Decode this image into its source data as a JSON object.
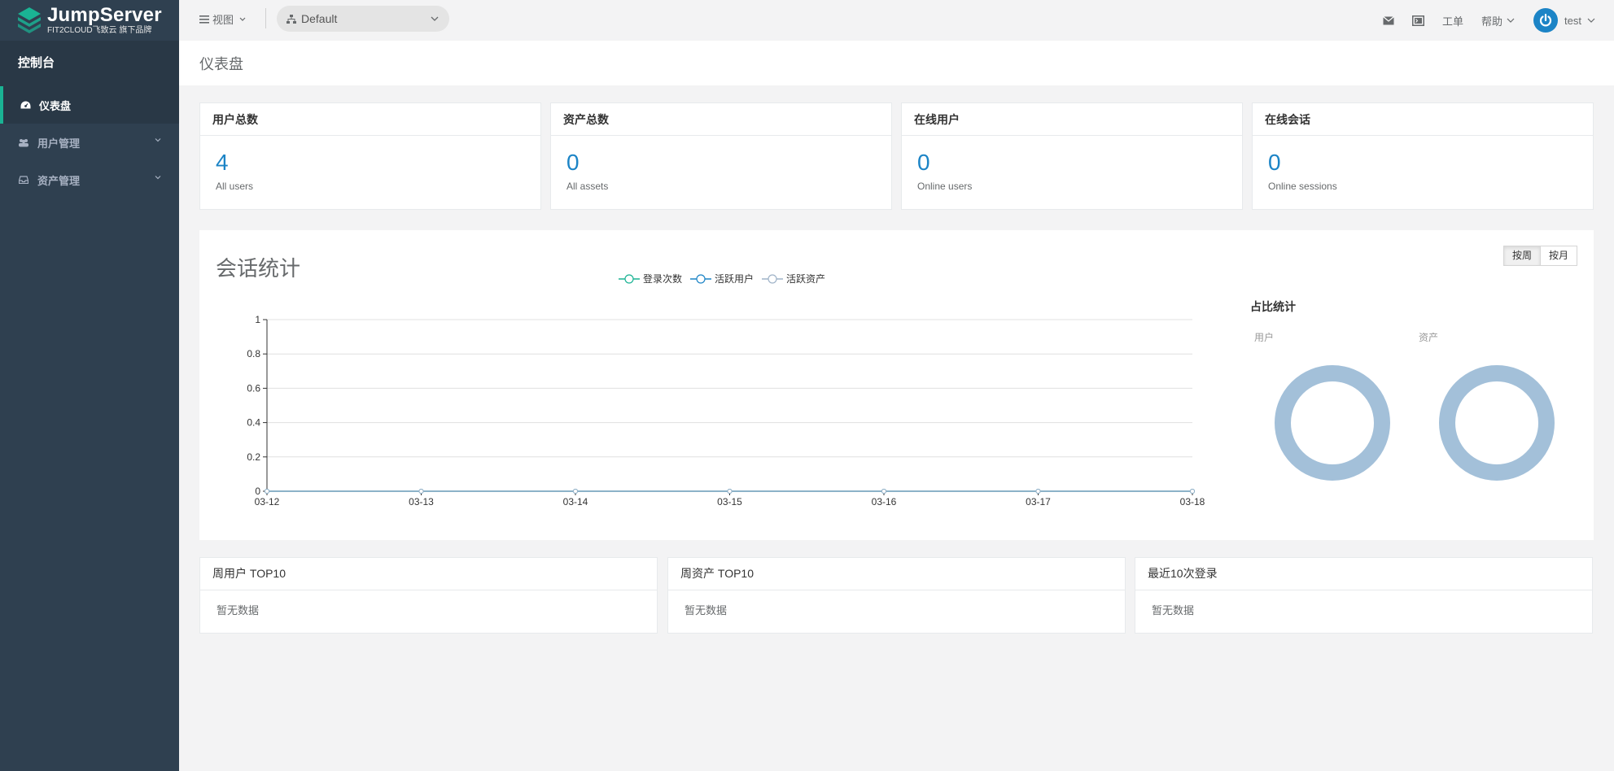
{
  "brand": {
    "title": "JumpServer",
    "subtitle": "FIT2CLOUD飞致云 旗下品牌"
  },
  "sidebar": {
    "console_label": "控制台",
    "items": [
      {
        "label": "仪表盘",
        "icon": "dashboard-icon",
        "active": true
      },
      {
        "label": "用户管理",
        "icon": "users-icon"
      },
      {
        "label": "资产管理",
        "icon": "inbox-icon"
      }
    ]
  },
  "topbar": {
    "view_label": "视图",
    "org_label": "Default",
    "ticket_label": "工单",
    "help_label": "帮助",
    "user_label": "test"
  },
  "page": {
    "title": "仪表盘"
  },
  "stats": [
    {
      "title": "用户总数",
      "value": "4",
      "label": "All users"
    },
    {
      "title": "资产总数",
      "value": "0",
      "label": "All assets"
    },
    {
      "title": "在线用户",
      "value": "0",
      "label": "Online users"
    },
    {
      "title": "在线会话",
      "value": "0",
      "label": "Online sessions"
    }
  ],
  "session_panel": {
    "title": "会话统计",
    "btn_week": "按周",
    "btn_month": "按月",
    "ratio_title": "占比统计",
    "donut_user_label": "用户",
    "donut_asset_label": "资产"
  },
  "colors": {
    "sidebar": "#2f4050",
    "accent": "#1ab394",
    "primary": "#1c84c6",
    "donut": "#a3c0d9"
  },
  "chart_data": {
    "type": "line",
    "x": [
      "03-12",
      "03-13",
      "03-14",
      "03-15",
      "03-16",
      "03-17",
      "03-18"
    ],
    "series": [
      {
        "name": "登录次数",
        "values": [
          0,
          0,
          0,
          0,
          0,
          0,
          0
        ],
        "color": "#1ab394"
      },
      {
        "name": "活跃用户",
        "values": [
          0,
          0,
          0,
          0,
          0,
          0,
          0
        ],
        "color": "#1c84c6"
      },
      {
        "name": "活跃资产",
        "values": [
          0,
          0,
          0,
          0,
          0,
          0,
          0
        ],
        "color": "#9fb3c8"
      }
    ],
    "ylim": [
      0,
      1
    ],
    "yticks": [
      0,
      0.2,
      0.4,
      0.6,
      0.8,
      1
    ],
    "grid": true,
    "legend": "top-center"
  },
  "bottom_panels": [
    {
      "title": "周用户 TOP10",
      "empty": "暂无数据"
    },
    {
      "title": "周资产 TOP10",
      "empty": "暂无数据"
    },
    {
      "title": "最近10次登录",
      "empty": "暂无数据"
    }
  ]
}
